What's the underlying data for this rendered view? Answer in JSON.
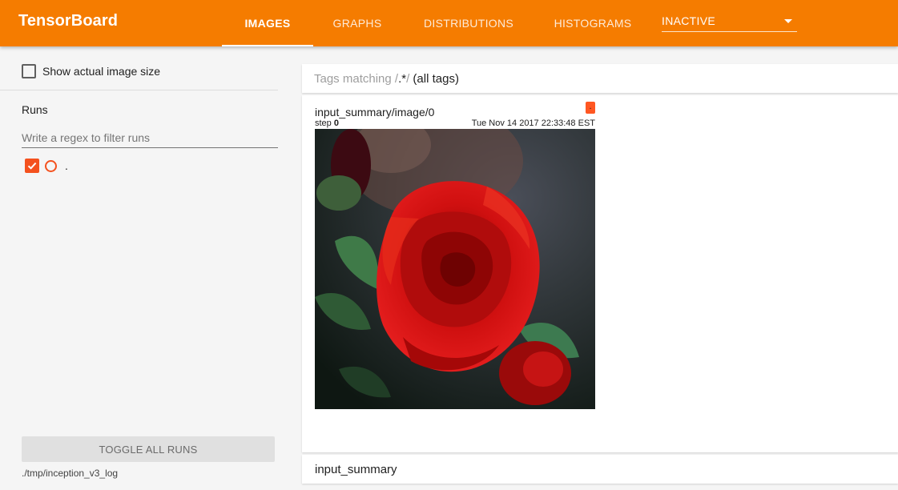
{
  "app": {
    "title": "TensorBoard"
  },
  "tabs": [
    {
      "label": "IMAGES",
      "active": true
    },
    {
      "label": "GRAPHS",
      "active": false
    },
    {
      "label": "DISTRIBUTIONS",
      "active": false
    },
    {
      "label": "HISTOGRAMS",
      "active": false
    }
  ],
  "inactive_dropdown": {
    "label": "INACTIVE"
  },
  "sidebar": {
    "show_actual_size_label": "Show actual image size",
    "show_actual_size_checked": false,
    "runs_title": "Runs",
    "regex_placeholder": "Write a regex to filter runs",
    "runs": [
      {
        "name": ".",
        "checked": true
      }
    ],
    "toggle_all_label": "TOGGLE ALL RUNS",
    "logdir": "./tmp/inception_v3_log"
  },
  "tags_filter": {
    "prefix": "Tags matching ",
    "slash_open": "/",
    "pattern": ".*",
    "slash_close": "/",
    "suffix": " (all tags)"
  },
  "image_card": {
    "tag": "input_summary/image/0",
    "run_badge": ".",
    "step_label": "step",
    "step_value": "0",
    "wall_time": "Tue Nov 14 2017 22:33:48 EST"
  },
  "group": {
    "label": "input_summary"
  },
  "colors": {
    "header": "#f57c00",
    "run_color": "#f4511e",
    "badge": "#ff5722"
  },
  "icons": {
    "dropdown": "caret-down-icon",
    "run_check": "checkmark-icon",
    "run_color": "circle-icon"
  }
}
